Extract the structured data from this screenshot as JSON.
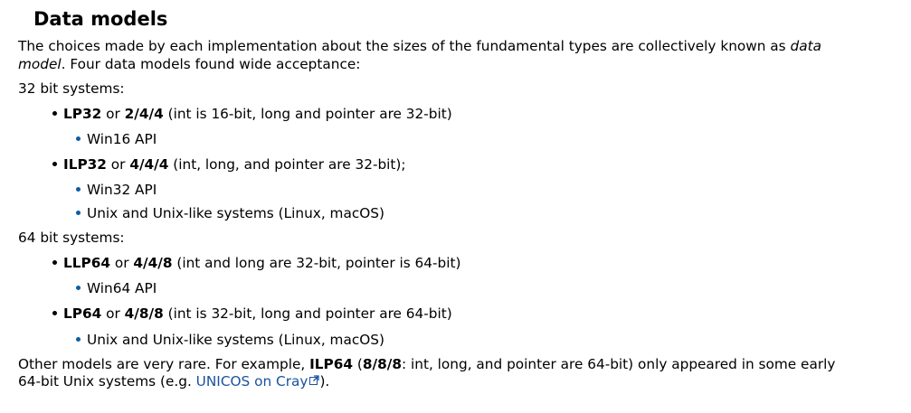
{
  "heading": "Data models",
  "intro": {
    "before_italic": "The choices made by each implementation about the sizes of the fundamental types are collectively known as ",
    "italic_line1": "data",
    "italic_line2": "model",
    "after_italic": ". Four data models found wide acceptance:"
  },
  "groups": [
    {
      "label": "32 bit systems:",
      "models": [
        {
          "name": "LP32",
          "connector": " or ",
          "sizes": "2/4/4",
          "desc": " (int is 16-bit, long and pointer are 32-bit)",
          "platforms": [
            "Win16 API"
          ]
        },
        {
          "name": "ILP32",
          "connector": " or ",
          "sizes": "4/4/4",
          "desc": " (int, long, and pointer are 32-bit);",
          "platforms": [
            "Win32 API",
            "Unix and Unix-like systems (Linux, macOS)"
          ]
        }
      ]
    },
    {
      "label": "64 bit systems:",
      "models": [
        {
          "name": "LLP64",
          "connector": " or ",
          "sizes": "4/4/8",
          "desc": " (int and long are 32-bit, pointer is 64-bit)",
          "platforms": [
            "Win64 API"
          ]
        },
        {
          "name": "LP64",
          "connector": " or ",
          "sizes": "4/8/8",
          "desc": " (int is 32-bit, long and pointer are 64-bit)",
          "platforms": [
            "Unix and Unix-like systems (Linux, macOS)"
          ]
        }
      ]
    }
  ],
  "closing": {
    "text1": "Other models are very rare. For example, ",
    "model_name": "ILP64",
    "text2": " (",
    "sizes": "8/8/8",
    "text3": ": int, long, and pointer are 64-bit) only appeared in some early",
    "line2_before": "64-bit Unix systems (e.g. ",
    "link_text": "UNICOS on Cray",
    "line2_after": ")."
  },
  "colors": {
    "link": "#1a52a0",
    "sub_bullet": "#0b5da3"
  },
  "icons": {
    "external_link": "external-link-icon"
  }
}
